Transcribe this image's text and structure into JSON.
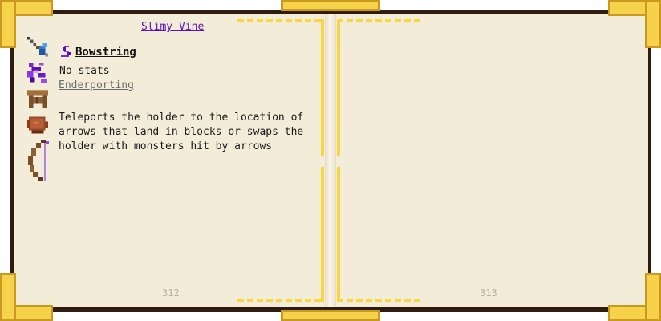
{
  "left_page": {
    "title_link": "Slimy Vine",
    "heading": "Bowstring",
    "stats": "No stats",
    "modifier_link": "Enderporting",
    "description": "Teleports the holder to the location of\narrows that land in blocks or swaps the\nholder with monsters hit by arrows",
    "page_number": "312",
    "icons": [
      "arrow-feather-icon",
      "ender-vine-icon",
      "crafting-table-icon",
      "leather-icon",
      "bow-icon"
    ]
  },
  "right_page": {
    "page_number": "313"
  },
  "colors": {
    "link": "#5a10b8",
    "gold": "#f7d640",
    "paper": "#f3ecd9",
    "cover": "#2e1d0e"
  }
}
